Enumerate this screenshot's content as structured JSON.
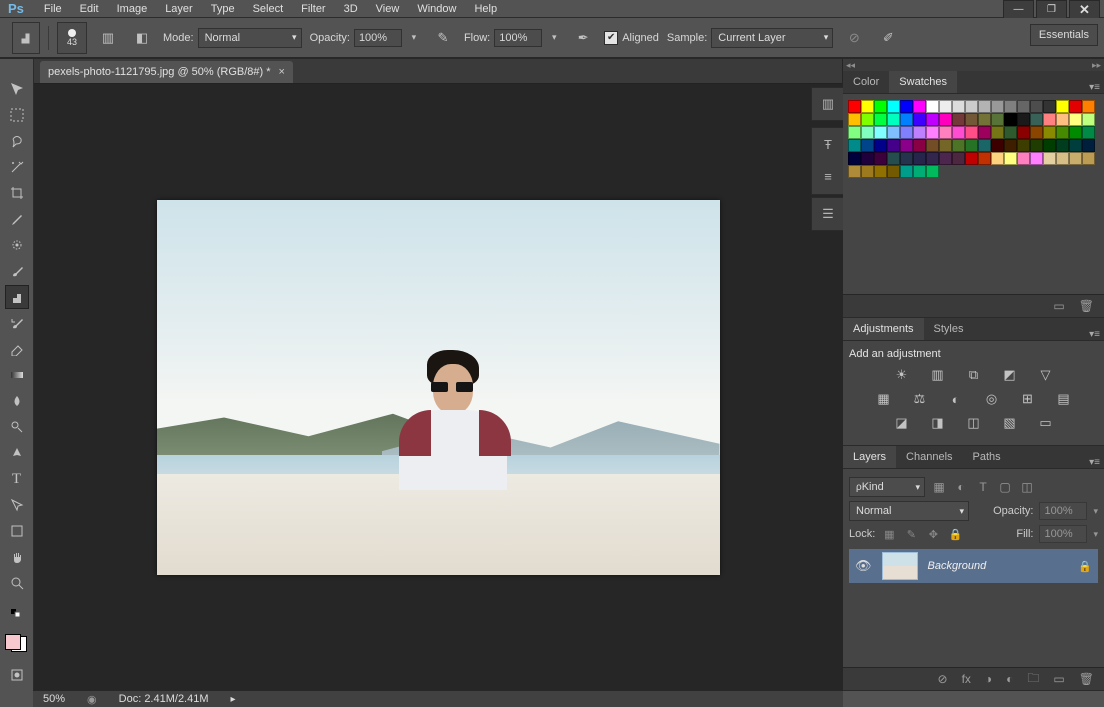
{
  "menu": {
    "items": [
      "File",
      "Edit",
      "Image",
      "Layer",
      "Type",
      "Select",
      "Filter",
      "3D",
      "View",
      "Window",
      "Help"
    ]
  },
  "window_buttons": {
    "min": "—",
    "max": "❐",
    "close": "✕"
  },
  "options": {
    "brush_size": "43",
    "mode_label": "Mode:",
    "mode_value": "Normal",
    "opacity_label": "Opacity:",
    "opacity_value": "100%",
    "flow_label": "Flow:",
    "flow_value": "100%",
    "aligned_label": "Aligned",
    "sample_label": "Sample:",
    "sample_value": "Current Layer",
    "workspace": "Essentials"
  },
  "doc": {
    "tab": "pexels-photo-1121795.jpg @ 50% (RGB/8#) *"
  },
  "status": {
    "zoom": "50%",
    "doc": "Doc: 2.41M/2.41M"
  },
  "panel_color": {
    "tab1": "Color",
    "tab2": "Swatches"
  },
  "panel_adj": {
    "tab1": "Adjustments",
    "tab2": "Styles",
    "heading": "Add an adjustment"
  },
  "panel_layers": {
    "tab1": "Layers",
    "tab2": "Channels",
    "tab3": "Paths",
    "filter_kind": "Kind",
    "blend": "Normal",
    "opacity_label": "Opacity:",
    "opacity_value": "100%",
    "lock_label": "Lock:",
    "fill_label": "Fill:",
    "fill_value": "100%",
    "layer_name": "Background"
  },
  "swatch_colors": [
    "#ff0000",
    "#ffff00",
    "#00ff00",
    "#00ffff",
    "#0000ff",
    "#ff00ff",
    "#ffffff",
    "#ededed",
    "#dcdcdc",
    "#cccccc",
    "#b3b3b3",
    "#999999",
    "#808080",
    "#666666",
    "#4d4d4d",
    "#333333",
    "#ffff00",
    "#e30000",
    "#ff8000",
    "#ffbf00",
    "#80ff00",
    "#00ff40",
    "#00ffbf",
    "#0080ff",
    "#4000ff",
    "#bf00ff",
    "#ff00bf",
    "#733838",
    "#735838",
    "#737338",
    "#587338",
    "#000000",
    "#1a1a1a",
    "#386158",
    "#ff8080",
    "#ffbf80",
    "#ffff80",
    "#bfff80",
    "#80ff80",
    "#80ffbf",
    "#80ffff",
    "#80bfff",
    "#8080ff",
    "#bf80ff",
    "#ff80ff",
    "#ff80bf",
    "#ff4dd2",
    "#ff4d88",
    "#9e005d",
    "#757516",
    "#2e5a2e",
    "#8a0000",
    "#8a4500",
    "#8a8a00",
    "#458a00",
    "#008a00",
    "#008a45",
    "#008a8a",
    "#00458a",
    "#00008a",
    "#45008a",
    "#8a008a",
    "#8a0045",
    "#734d26",
    "#736626",
    "#4d7326",
    "#267326",
    "#1a6666",
    "#3d0000",
    "#3d1f00",
    "#3d3d00",
    "#1f3d00",
    "#003d00",
    "#003d1f",
    "#003d3d",
    "#001f3d",
    "#00003d",
    "#1f003d",
    "#3d003d",
    "#264d4d",
    "#26334d",
    "#26264d",
    "#33264d",
    "#4d264d",
    "#4d2640",
    "#c00000",
    "#c03000",
    "#ffd27f",
    "#ffff7f",
    "#ff7fbf",
    "#ff7fff",
    "#e4cfa1",
    "#d7be86",
    "#c9ad6c",
    "#bb9c52",
    "#ad8b38",
    "#9e7a1e",
    "#907000",
    "#735a00",
    "#009e8a",
    "#00ad75",
    "#00bb5e"
  ]
}
